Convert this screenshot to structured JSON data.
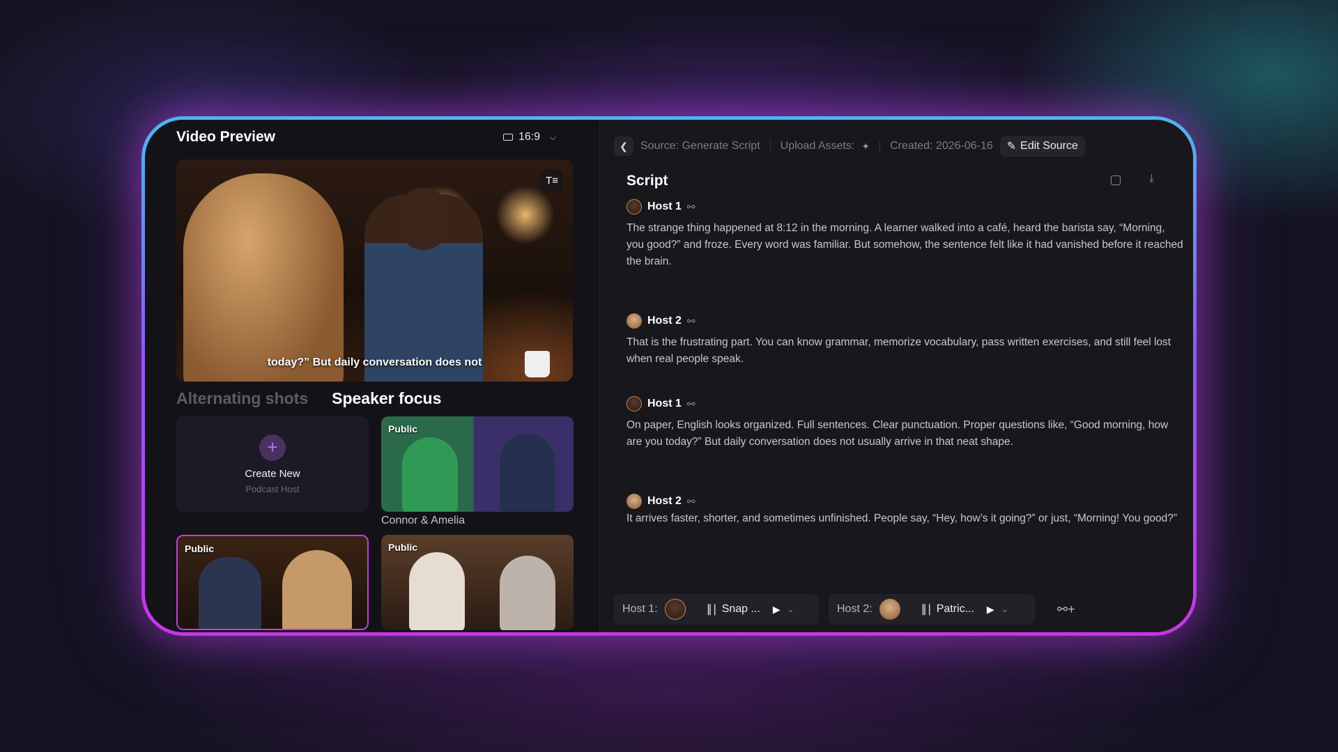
{
  "left": {
    "title": "Video Preview",
    "aspect_ratio": "16:9",
    "subtitle": "today?” But daily conversation does not",
    "tabs": [
      "Alternating shots",
      "Speaker focus"
    ],
    "active_tab": "Speaker focus",
    "create_card": {
      "title": "Create New",
      "subtitle": "Podcast Host"
    },
    "thumbnails": [
      {
        "badge": "Public",
        "label": "Connor & Amelia"
      },
      {
        "badge": "Public"
      },
      {
        "badge": "Public"
      }
    ]
  },
  "right": {
    "breadcrumbs": {
      "source": "Source: Generate Script",
      "upload": "Upload Assets:",
      "created": "Created: 2026-06-16",
      "edit": "Edit Source"
    },
    "title": "Script",
    "blocks": [
      {
        "host": "Host 1",
        "text": "The strange thing happened at 8:12 in the morning. A learner walked into a café, heard the barista say, “Morning, you good?” and froze. Every word was familiar. But somehow, the sentence felt like it had vanished before it reached the brain."
      },
      {
        "host": "Host 2",
        "text": "That is the frustrating part. You can know grammar, memorize vocabulary, pass written exercises, and still feel lost when real people speak."
      },
      {
        "host": "Host 1",
        "text": "On paper, English looks organized. Full sentences. Clear punctuation. Proper questions like, “Good morning, how are you today?” But daily conversation does not usually arrive in that neat shape."
      },
      {
        "host": "Host 2",
        "text": "It arrives faster, shorter, and sometimes unfinished. People say, “Hey, how’s it going?” or just, “Morning! You good?”"
      }
    ],
    "voices": [
      {
        "label": "Host 1:",
        "voice": "Snap ..."
      },
      {
        "label": "Host 2:",
        "voice": "Patric..."
      }
    ]
  },
  "colors": {
    "accent": "#c23de0",
    "frame_top": "#4bb8f0",
    "frame_bottom": "#c736e6"
  },
  "icons": [
    "aspect-ratio-icon",
    "chevron-down-icon",
    "captions-icon",
    "plus-icon",
    "back-icon",
    "sparkle-icon",
    "edit-icon",
    "copy-icon",
    "download-icon",
    "person-icon",
    "waveform-icon",
    "play-icon",
    "add-person-icon"
  ]
}
